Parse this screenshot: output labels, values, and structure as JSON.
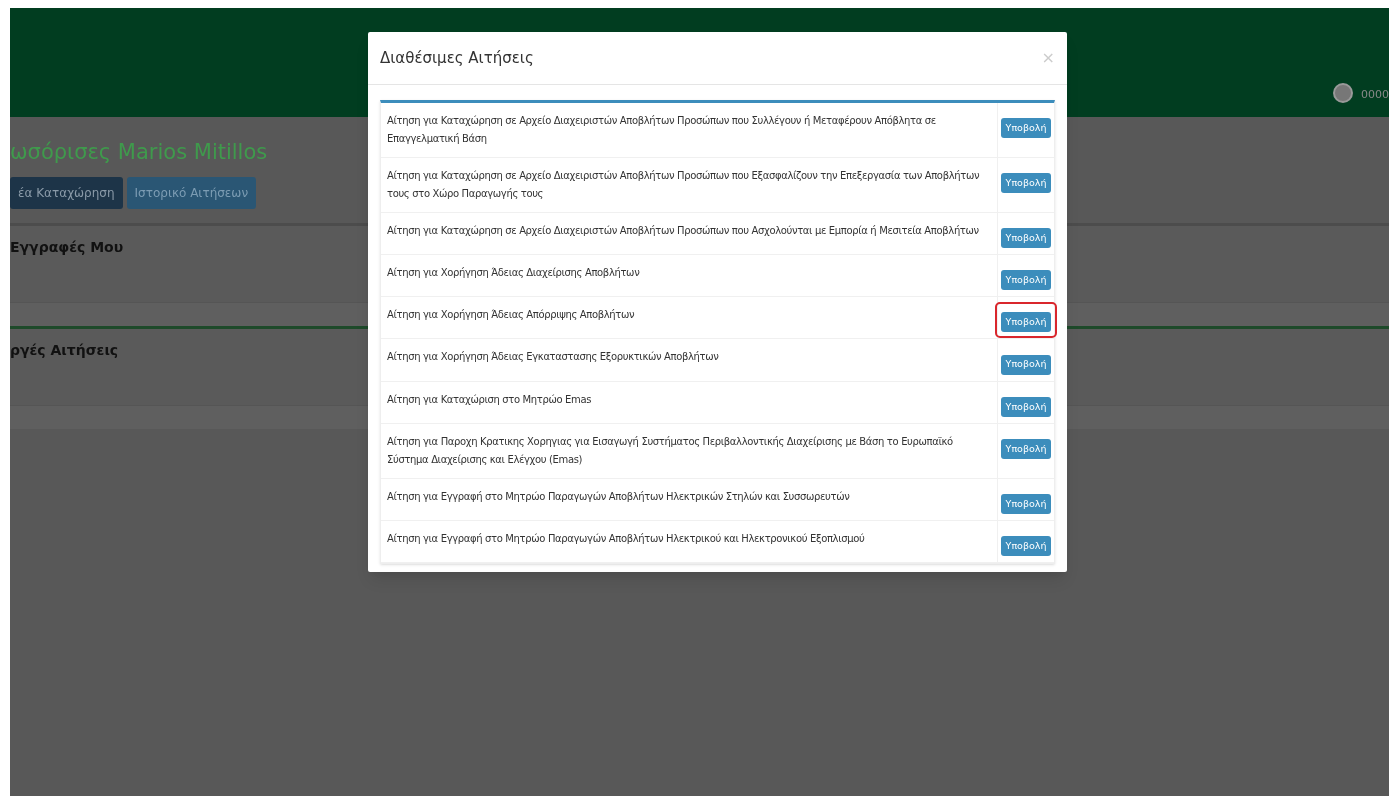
{
  "header": {
    "user": "0000"
  },
  "page": {
    "title": "ωσόρισες Marios Mitillos",
    "buttons": [
      {
        "label": "έα Καταχώρηση",
        "selected": true
      },
      {
        "label": "Ιστορικό Αιτήσεων",
        "selected": false
      }
    ],
    "sections": [
      {
        "title": "Εγγραφές Μου"
      },
      {
        "title": "ργές Αιτήσεις"
      }
    ]
  },
  "modal": {
    "title": "Διαθέσιμες Αιτήσεις",
    "close": "×",
    "rows": [
      {
        "text": "Αίτηση για Καταχώρηση σε Αρχείο Διαχειριστών Αποβλήτων Προσώπων που Συλλέγουν ή Μεταφέρουν Απόβλητα σε Επαγγελματική Βάση",
        "button": "Υποβολή",
        "highlighted": false
      },
      {
        "text": "Αίτηση για Καταχώρηση σε Αρχείο Διαχειριστών Αποβλήτων Προσώπων που Εξασφαλίζουν την Επεξεργασία των Αποβλήτων τους στο Χώρο Παραγωγής τους",
        "button": "Υποβολή",
        "highlighted": false
      },
      {
        "text": "Αίτηση για Καταχώρηση σε Αρχείο Διαχειριστών Αποβλήτων Προσώπων που Ασχολούνται με Εμπορία ή Μεσιτεία Αποβλήτων",
        "button": "Υποβολή",
        "highlighted": false
      },
      {
        "text": "Αίτηση για Χορήγηση Άδειας Διαχείρισης Αποβλήτων",
        "button": "Υποβολή",
        "highlighted": false
      },
      {
        "text": "Αίτηση για Χορήγηση Άδειας Απόρριψης Αποβλήτων",
        "button": "Υποβολή",
        "highlighted": true
      },
      {
        "text": "Αίτηση για Χορήγηση Άδειας Εγκαταστασης Εξορυκτικών Αποβλήτων",
        "button": "Υποβολή",
        "highlighted": false
      },
      {
        "text": "Αίτηση για Καταχώριση στο Μητρώο Emas",
        "button": "Υποβολή",
        "highlighted": false
      },
      {
        "text": "Αίτηση για Παροχη Κρατικης Χορηγιας για Εισαγωγή Συστήματος Περιβαλλοντικής Διαχείρισης με Βάση το Ευρωπαϊκό Σύστημα Διαχείρισης και Ελέγχου (Emas)",
        "button": "Υποβολή",
        "highlighted": false
      },
      {
        "text": "Αίτηση για Εγγραφή στο Μητρώο Παραγωγών Αποβλήτων Ηλεκτρικών Στηλών και Συσσωρευτών",
        "button": "Υποβολή",
        "highlighted": false
      },
      {
        "text": "Αίτηση για Εγγραφή στο Μητρώο Παραγωγών Αποβλήτων Ηλεκτρικού και Ηλεκτρονικού Εξοπλισμού",
        "button": "Υποβολή",
        "highlighted": false
      }
    ]
  }
}
